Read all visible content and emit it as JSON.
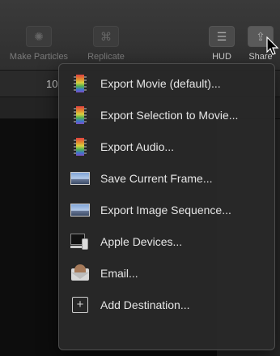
{
  "toolbar": {
    "make_particles": "Make Particles",
    "replicate": "Replicate",
    "hud": "HUD",
    "share": "Share"
  },
  "subbar": {
    "value": "10"
  },
  "share_menu": {
    "items": [
      {
        "label": "Export Movie (default)...",
        "icon": "film-icon"
      },
      {
        "label": "Export Selection to Movie...",
        "icon": "film-icon"
      },
      {
        "label": "Export Audio...",
        "icon": "film-icon"
      },
      {
        "label": "Save Current Frame...",
        "icon": "landscape-icon"
      },
      {
        "label": "Export Image Sequence...",
        "icon": "landscape-icon"
      },
      {
        "label": "Apple Devices...",
        "icon": "devices-icon"
      },
      {
        "label": "Email...",
        "icon": "envelope-icon"
      },
      {
        "label": "Add Destination...",
        "icon": "plus-icon"
      }
    ]
  }
}
